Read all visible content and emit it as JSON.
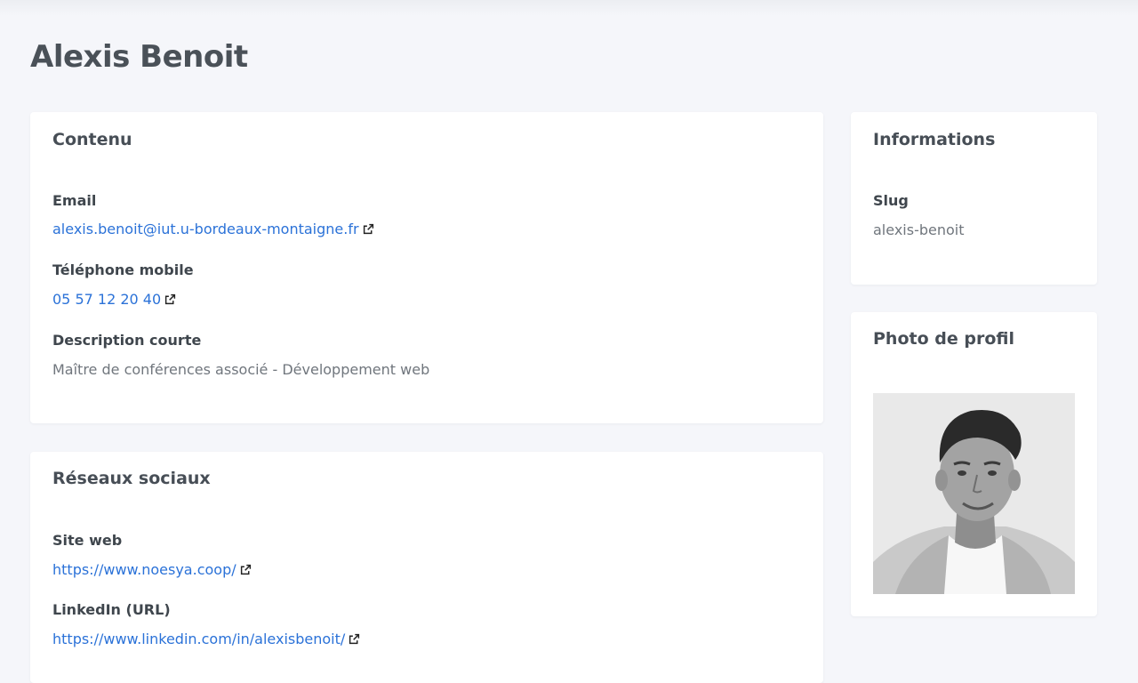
{
  "page": {
    "title": "Alexis Benoit"
  },
  "contenu": {
    "title": "Contenu",
    "email_label": "Email",
    "email_value": "alexis.benoit@iut.u-bordeaux-montaigne.fr",
    "phone_label": "Téléphone mobile",
    "phone_value": "05 57 12 20 40",
    "description_label": "Description courte",
    "description_value": "Maître de conférences associé - Développement web"
  },
  "reseaux": {
    "title": "Réseaux sociaux",
    "website_label": "Site web",
    "website_value": "https://www.noesya.coop/",
    "linkedin_label": "LinkedIn (URL)",
    "linkedin_value": "https://www.linkedin.com/in/alexisbenoit/"
  },
  "informations": {
    "title": "Informations",
    "slug_label": "Slug",
    "slug_value": "alexis-benoit"
  },
  "photo": {
    "title": "Photo de profil"
  },
  "icons": {
    "external_link": "external-link-icon"
  },
  "colors": {
    "link": "#2b72d8",
    "background": "#f5f6fa",
    "card": "#ffffff"
  }
}
